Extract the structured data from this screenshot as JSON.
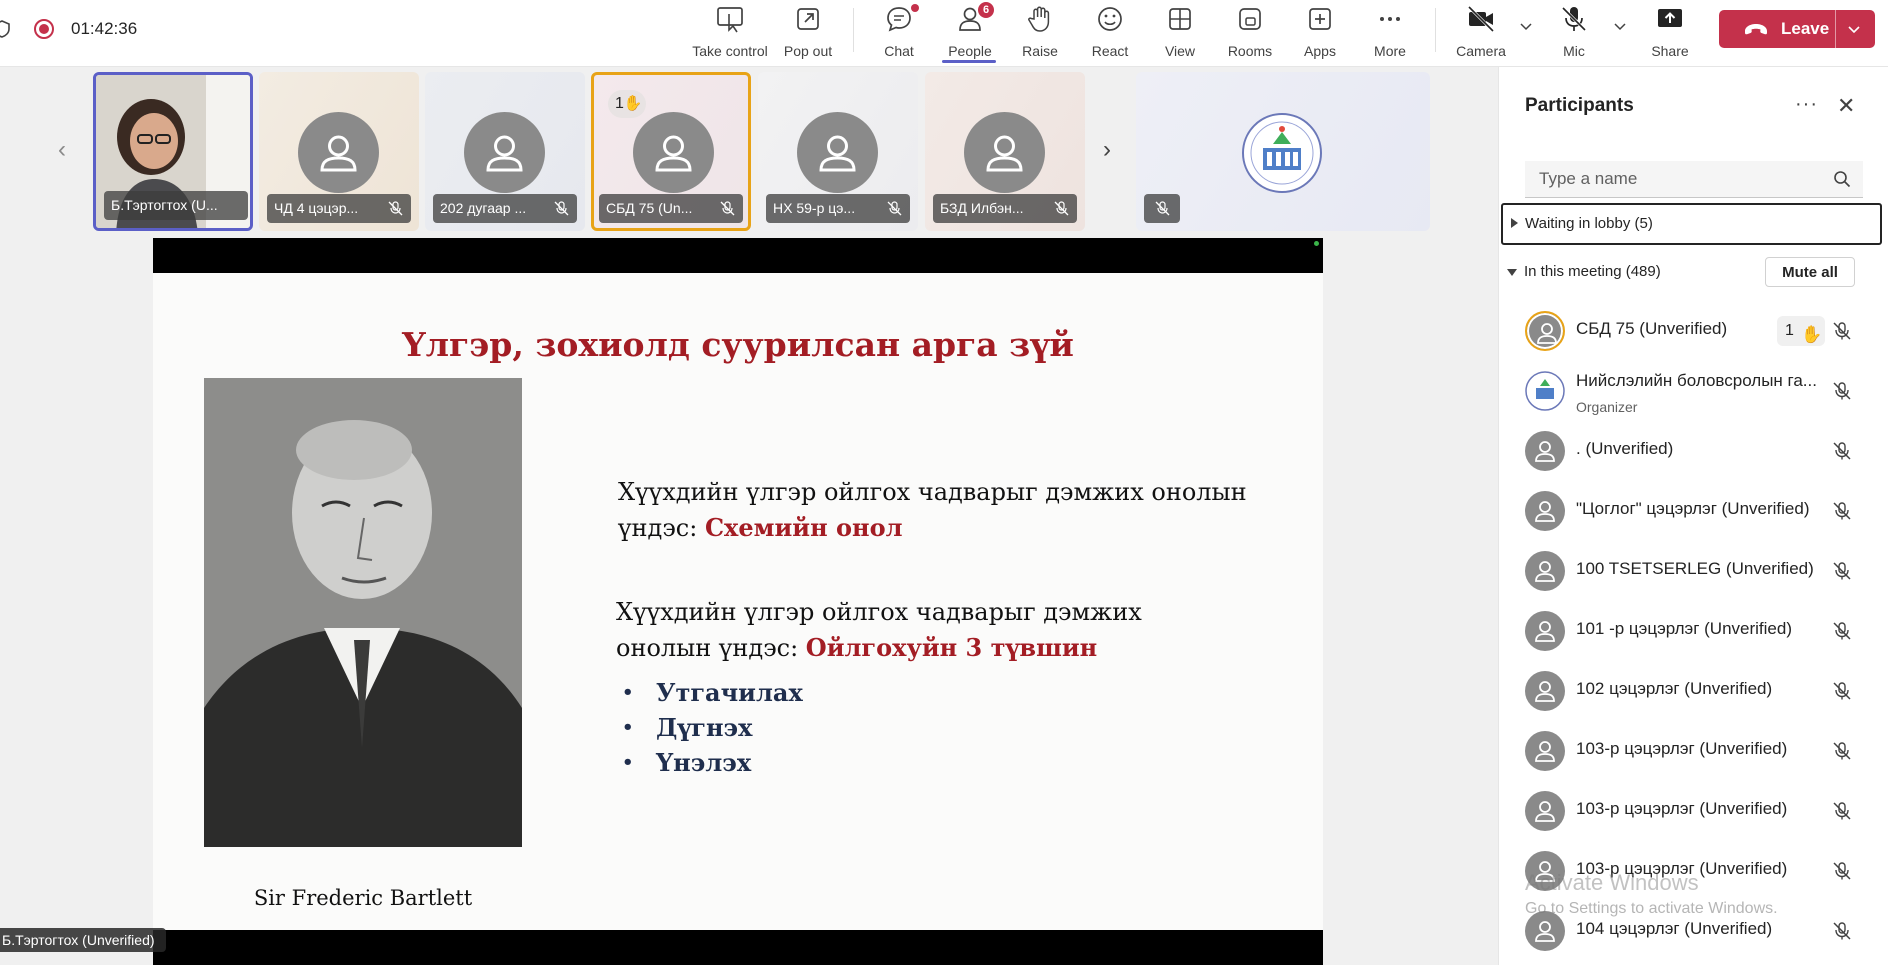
{
  "header": {
    "timer": "01:42:36",
    "buttons": {
      "take_control": "Take control",
      "pop_out": "Pop out",
      "chat": "Chat",
      "people": "People",
      "people_badge": "6",
      "raise": "Raise",
      "react": "React",
      "view": "View",
      "rooms": "Rooms",
      "apps": "Apps",
      "more": "More",
      "camera": "Camera",
      "mic": "Mic",
      "share": "Share",
      "leave": "Leave"
    }
  },
  "gallery": {
    "tiles": [
      {
        "name": "Б.Тэртогтох (U..."
      },
      {
        "name": "ЧД 4 цэцэр..."
      },
      {
        "name": "202 дугаар ..."
      },
      {
        "name": "СБД 75 (Un...",
        "raised_hand_count": "1"
      },
      {
        "name": "НХ 59-р цэ..."
      },
      {
        "name": "БЗД Илбэн..."
      },
      {
        "name": ""
      }
    ]
  },
  "slide": {
    "title": "Үлгэр, зохиолд суурилсан арга зүй",
    "photo_caption": "Sir Frederic Bartlett",
    "para1_line1": "Хүүхдийн үлгэр ойлгох чадварыг дэмжих онолын",
    "para1_line2_prefix": "үндэс: ",
    "para1_highlight": "Схемийн онол",
    "para2_line1": "Хүүхдийн үлгэр ойлгох чадварыг дэмжих",
    "para2_line2_prefix": "онолын үндэс: ",
    "para2_highlight": "Ойлгохуйн 3 түвшин",
    "bullets": [
      "Утгачилах",
      "Дүгнэх",
      "Үнэлэх"
    ]
  },
  "self_view_name": "Б.Тэртогтох (Unverified)",
  "participants_panel": {
    "title": "Participants",
    "search_placeholder": "Type a name",
    "waiting_lobby": "Waiting in lobby (5)",
    "in_meeting": "In this meeting (489)",
    "mute_all": "Mute all",
    "list": [
      {
        "name": "СБД 75 (Unverified)",
        "hand": "1"
      },
      {
        "name": "Нийслэлийн боловсролын га...",
        "role": "Organizer"
      },
      {
        "name": ". (Unverified)"
      },
      {
        "name": "\"Цоглог\" цэцэрлэг (Unverified)"
      },
      {
        "name": "100 TSETSERLEG (Unverified)"
      },
      {
        "name": "101 -р цэцэрлэг (Unverified)"
      },
      {
        "name": "102 цэцэрлэг (Unverified)"
      },
      {
        "name": "103-р цэцэрлэг (Unverified)"
      },
      {
        "name": "103-р цэцэрлэг (Unverified)"
      },
      {
        "name": "103-р цэцэрлэг (Unverified)"
      },
      {
        "name": "104 цэцэрлэг (Unverified)"
      }
    ],
    "watermark_title": "Activate Windows",
    "watermark_sub": "Go to Settings to activate Windows."
  },
  "colors": {
    "accent": "#5b5fc7",
    "leave_red": "#c4314b",
    "slide_title_red": "#a31d24",
    "raised_hand_border": "#e8a317"
  }
}
